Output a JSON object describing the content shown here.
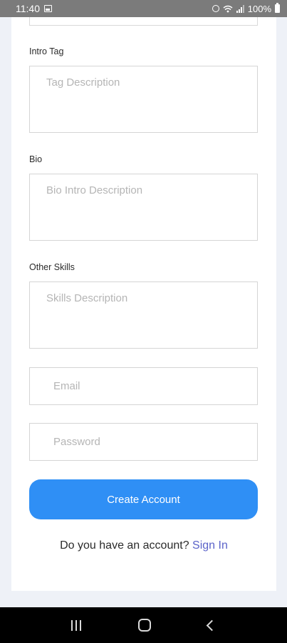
{
  "status_bar": {
    "time": "11:40",
    "battery": "100%",
    "icons": [
      "gallery-icon",
      "alarm-icon",
      "wifi-icon",
      "signal-icon",
      "battery-icon"
    ]
  },
  "form": {
    "intro_tag": {
      "label": "Intro Tag",
      "placeholder": "Tag Description"
    },
    "bio": {
      "label": "Bio",
      "placeholder": "Bio Intro Description"
    },
    "other_skills": {
      "label": "Other Skills",
      "placeholder": "Skills Description"
    },
    "email": {
      "placeholder": "Email"
    },
    "password": {
      "placeholder": "Password"
    },
    "create_account_label": "Create Account",
    "signin_prompt": "Do you have an account?",
    "signin_link": "Sign In"
  },
  "nav_bar": {
    "icons": [
      "recents-icon",
      "home-icon",
      "back-icon"
    ]
  },
  "colors": {
    "primary": "#2f8ff5",
    "link": "#5b63c9",
    "background": "#eef1f7"
  }
}
